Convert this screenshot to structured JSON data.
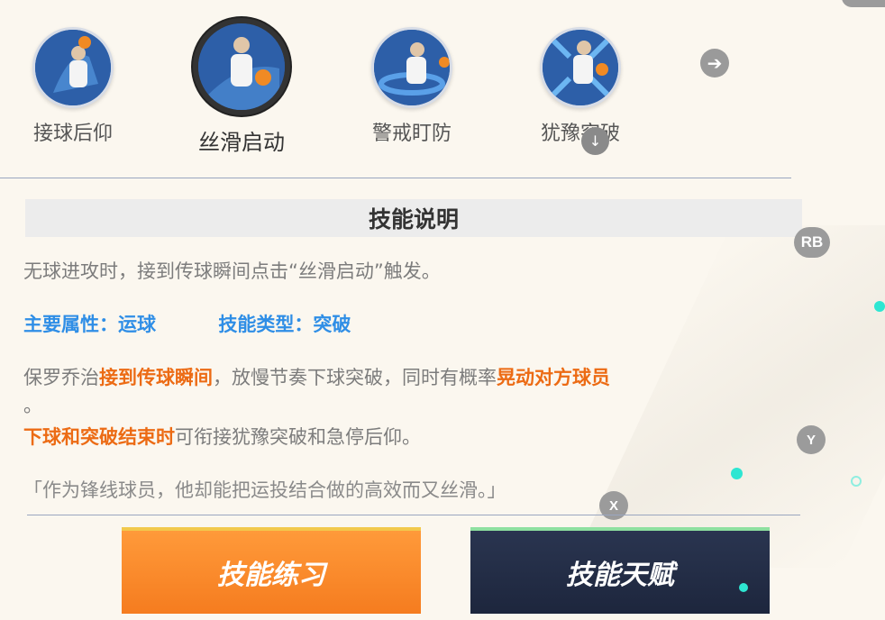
{
  "skills": [
    {
      "label": "接球后仰",
      "icon": "catch-fadeaway-icon"
    },
    {
      "label": "丝滑启动",
      "icon": "silky-start-icon"
    },
    {
      "label": "警戒盯防",
      "icon": "guard-defense-icon"
    },
    {
      "label": "犹豫突破",
      "icon": "hesitation-drive-icon"
    }
  ],
  "selected_skill": "丝滑启动",
  "description": {
    "header": "技能说明",
    "trigger": "无球进攻时，接到传球瞬间点击“丝滑启动”触发。",
    "attribute": "主要属性：运球",
    "type": "技能类型：突破",
    "line1_a": "保罗乔治",
    "line1_b": "接到传球瞬间",
    "line1_c": "，放慢节奏下球突破，同时有概率",
    "line1_d": "晃动对方球员",
    "line1_end": "。",
    "line2_a": "下球和突破结束时",
    "line2_b": "可衔接犹豫突破和急停后仰。",
    "quote": "「作为锋线球员，他却能把运投结合做的高效而又丝滑。」"
  },
  "buttons": {
    "practice": "技能练习",
    "talent": "技能天赋"
  },
  "gamepad": {
    "rb": "RB",
    "y": "Y",
    "x": "X"
  },
  "colors": {
    "accent_blue": "#2f8ee6",
    "accent_orange": "#ec6b14",
    "practice_button": "#f57c1f",
    "talent_button": "#1d263d"
  }
}
